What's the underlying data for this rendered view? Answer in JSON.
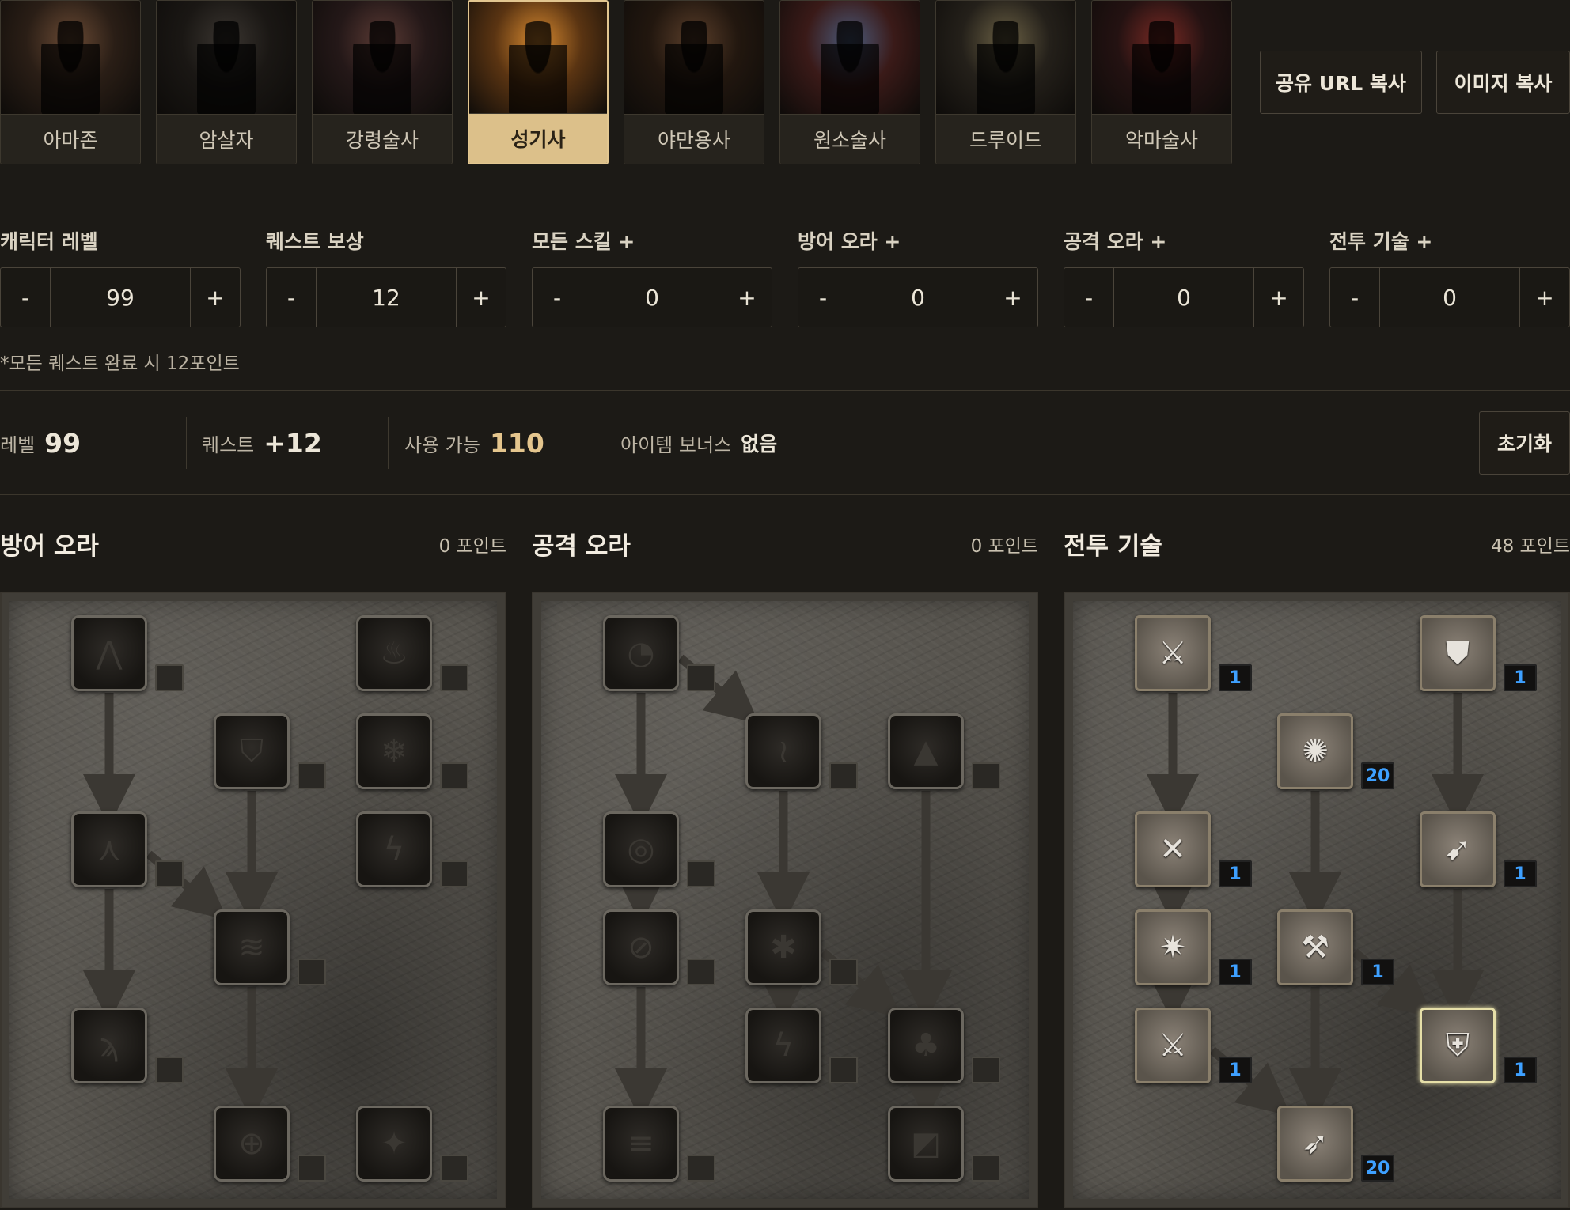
{
  "classes": [
    {
      "name": "아마존",
      "active": false,
      "c1": "#6a4a34",
      "c2": "#2a1e16"
    },
    {
      "name": "암살자",
      "active": false,
      "c1": "#3a3530",
      "c2": "#1a1714"
    },
    {
      "name": "강령술사",
      "active": false,
      "c1": "#5a3a34",
      "c2": "#241818"
    },
    {
      "name": "성기사",
      "active": true,
      "c1": "#d88a30",
      "c2": "#5a3412"
    },
    {
      "name": "야만용사",
      "active": false,
      "c1": "#5a3e2a",
      "c2": "#22170f"
    },
    {
      "name": "원소술사",
      "active": false,
      "c1": "#4a5a7a",
      "c2": "#3a1a18"
    },
    {
      "name": "드루이드",
      "active": false,
      "c1": "#6a6044",
      "c2": "#24201a"
    },
    {
      "name": "악마술사",
      "active": false,
      "c1": "#7a2a24",
      "c2": "#241212"
    }
  ],
  "actions": {
    "share_url": "공유 URL 복사",
    "copy_image": "이미지 복사"
  },
  "steppers": [
    {
      "label": "캐릭터 레벨",
      "value": "99"
    },
    {
      "label": "퀘스트 보상",
      "value": "12"
    },
    {
      "label": "모든 스킬 +",
      "value": "0"
    },
    {
      "label": "방어 오라 +",
      "value": "0"
    },
    {
      "label": "공격 오라 +",
      "value": "0"
    },
    {
      "label": "전투 기술 +",
      "value": "0"
    }
  ],
  "stepper_minus": "-",
  "stepper_plus": "+",
  "quest_note": "*모든 퀘스트 완료 시 12포인트",
  "summary": {
    "level_label": "레벨",
    "level_value": "99",
    "quest_label": "퀘스트",
    "quest_value": "+12",
    "available_label": "사용 가능",
    "available_value": "110",
    "item_bonus_label": "아이템 보너스",
    "item_bonus_value": "없음"
  },
  "reset_label": "초기화",
  "trees": [
    {
      "title": "방어 오라",
      "points": "0 포인트",
      "skills": [
        {
          "icon": "prayer-aura-icon",
          "glyph": "⋀"
        },
        {
          "icon": "resist-fire-aura-icon",
          "glyph": "♨"
        },
        {
          "icon": "defiance-aura-icon",
          "glyph": "⛉"
        },
        {
          "icon": "resist-cold-aura-icon",
          "glyph": "❄"
        },
        {
          "icon": "cleansing-aura-icon",
          "glyph": "⋏"
        },
        {
          "icon": "resist-lightning-aura-icon",
          "glyph": "ϟ"
        },
        {
          "icon": "vigor-aura-icon",
          "glyph": "≋"
        },
        {
          "icon": "meditation-aura-icon",
          "glyph": "ϡ"
        },
        {
          "icon": "redemption-aura-icon",
          "glyph": "⊕"
        },
        {
          "icon": "salvation-aura-icon",
          "glyph": "✦"
        }
      ]
    },
    {
      "title": "공격 오라",
      "points": "0 포인트",
      "skills": [
        {
          "icon": "might-aura-icon",
          "glyph": "◔"
        },
        {
          "icon": "holy-fire-aura-icon",
          "glyph": "≀"
        },
        {
          "icon": "precision-aura-icon",
          "glyph": "▲"
        },
        {
          "icon": "blessed-aim-aura-icon",
          "glyph": "◎"
        },
        {
          "icon": "concentration-aura-icon",
          "glyph": "⊘"
        },
        {
          "icon": "holy-freeze-aura-icon",
          "glyph": "✱"
        },
        {
          "icon": "holy-shock-aura-icon",
          "glyph": "ϟ"
        },
        {
          "icon": "sanctuary-aura-icon",
          "glyph": "♣"
        },
        {
          "icon": "fanaticism-aura-icon",
          "glyph": "≡"
        },
        {
          "icon": "conviction-aura-icon",
          "glyph": "◩"
        }
      ]
    },
    {
      "title": "전투 기술",
      "points": "48 포인트",
      "skills": [
        {
          "icon": "sacrifice-icon",
          "glyph": "⚔",
          "level": "1"
        },
        {
          "icon": "smite-icon",
          "glyph": "⛊",
          "level": "1"
        },
        {
          "icon": "holy-bolt-icon",
          "glyph": "✺",
          "level": "20"
        },
        {
          "icon": "zeal-icon",
          "glyph": "✕",
          "level": "1"
        },
        {
          "icon": "charge-icon",
          "glyph": "➹",
          "level": "1"
        },
        {
          "icon": "vengeance-icon",
          "glyph": "✷",
          "level": "1"
        },
        {
          "icon": "blessed-hammer-icon",
          "glyph": "⚒",
          "level": "1"
        },
        {
          "icon": "conversion-icon",
          "glyph": "⚔",
          "level": "1"
        },
        {
          "icon": "holy-shield-icon",
          "glyph": "⛨",
          "level": "1",
          "selected": true
        },
        {
          "icon": "fist-of-the-heavens-icon",
          "glyph": "➶",
          "level": "20"
        }
      ]
    }
  ]
}
